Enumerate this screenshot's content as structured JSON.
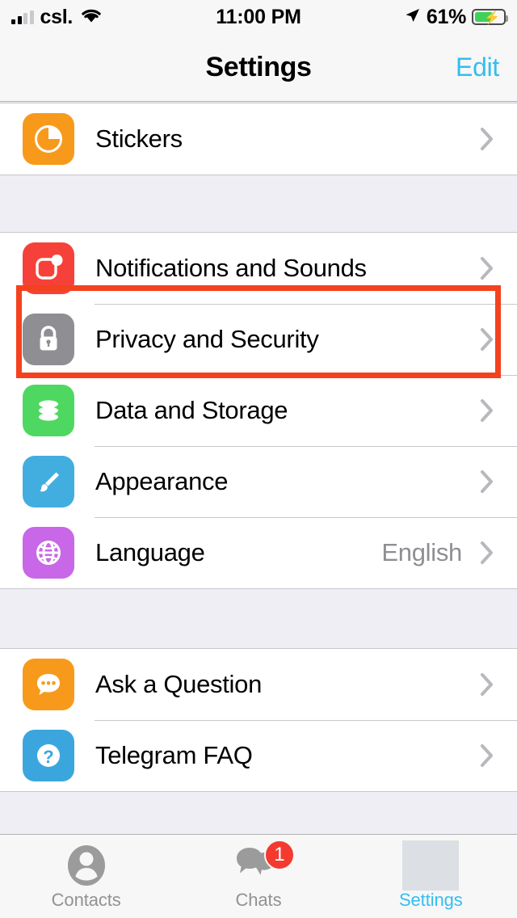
{
  "status_bar": {
    "carrier": "csl.",
    "time": "11:00 PM",
    "battery_percent": "61%",
    "wifi_icon": "wifi-icon",
    "signal_icon": "signal-bars-icon",
    "location_icon": "location-arrow-icon",
    "battery_icon": "battery-charging-icon"
  },
  "nav": {
    "title": "Settings",
    "edit_label": "Edit"
  },
  "sections": [
    {
      "rows": [
        {
          "label": "Stickers",
          "value": "",
          "icon": "stickers-icon",
          "icon_color": "#F79A1C"
        }
      ]
    },
    {
      "rows": [
        {
          "label": "Notifications and Sounds",
          "value": "",
          "icon": "notifications-icon",
          "icon_color": "#F6413A"
        },
        {
          "label": "Privacy and Security",
          "value": "",
          "icon": "lock-icon",
          "icon_color": "#8E8E93"
        },
        {
          "label": "Data and Storage",
          "value": "",
          "icon": "database-icon",
          "icon_color": "#4FD861"
        },
        {
          "label": "Appearance",
          "value": "",
          "icon": "paintbrush-icon",
          "icon_color": "#42AEE0"
        },
        {
          "label": "Language",
          "value": "English",
          "icon": "globe-icon",
          "icon_color": "#C867E8"
        }
      ]
    },
    {
      "rows": [
        {
          "label": "Ask a Question",
          "value": "",
          "icon": "chat-bubble-icon",
          "icon_color": "#F79A1C"
        },
        {
          "label": "Telegram FAQ",
          "value": "",
          "icon": "question-mark-icon",
          "icon_color": "#3BA6DE"
        }
      ]
    }
  ],
  "highlight": {
    "target_label": "Privacy and Security",
    "color": "#F4411E"
  },
  "tabbar": {
    "tabs": [
      {
        "label": "Contacts",
        "icon": "person-icon",
        "badge": "",
        "active": false
      },
      {
        "label": "Chats",
        "icon": "chats-bubbles-icon",
        "badge": "1",
        "active": false
      },
      {
        "label": "Settings",
        "icon": "settings-placeholder-icon",
        "badge": "",
        "active": true
      }
    ],
    "active_color": "#33BEF0",
    "inactive_color": "#929292",
    "badge_color": "#F43A2F"
  }
}
